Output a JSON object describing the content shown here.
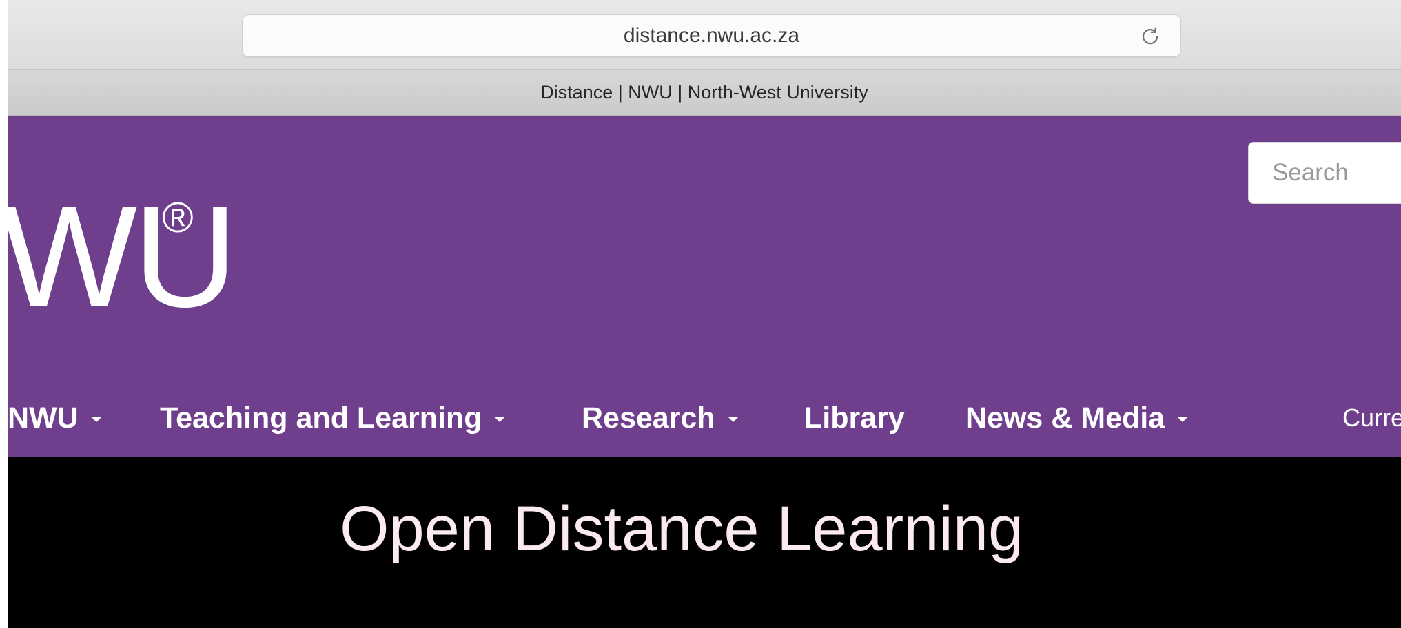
{
  "browser": {
    "url": "distance.nwu.ac.za",
    "tab_title": "Distance | NWU | North-West University"
  },
  "header": {
    "logo_text": "WU",
    "logo_reg": "®",
    "search_placeholder": "Search",
    "brand_color": "#6f3f8e"
  },
  "nav": {
    "items": [
      {
        "label": "NWU"
      },
      {
        "label": "Teaching and Learning"
      },
      {
        "label": "Research"
      },
      {
        "label": "Library"
      },
      {
        "label": "News & Media"
      }
    ],
    "current_partial": "Curre"
  },
  "hero": {
    "title": "Open Distance Learning",
    "background": "#000000"
  },
  "icons": {
    "reload": "reload-icon",
    "caret": "caret-down-icon"
  }
}
